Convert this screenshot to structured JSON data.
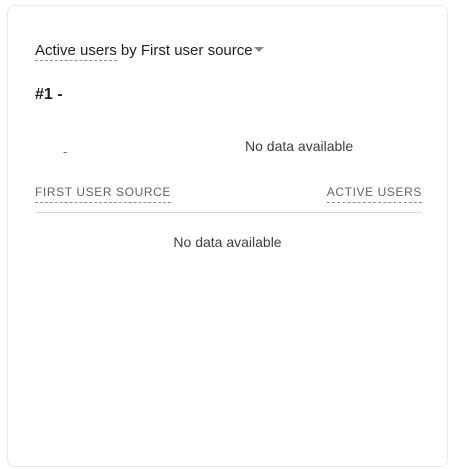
{
  "card": {
    "title_metric": "Active users",
    "title_by": " by ",
    "title_dimension": "First user source",
    "dropdown_icon": "caret-down-icon"
  },
  "summary": {
    "rank": "#1 -",
    "sparkline_value": "-",
    "sparkline_message": "No data available"
  },
  "table": {
    "columns": [
      "FIRST USER SOURCE",
      "ACTIVE USERS"
    ],
    "rows": [],
    "empty_message": "No data available"
  }
}
